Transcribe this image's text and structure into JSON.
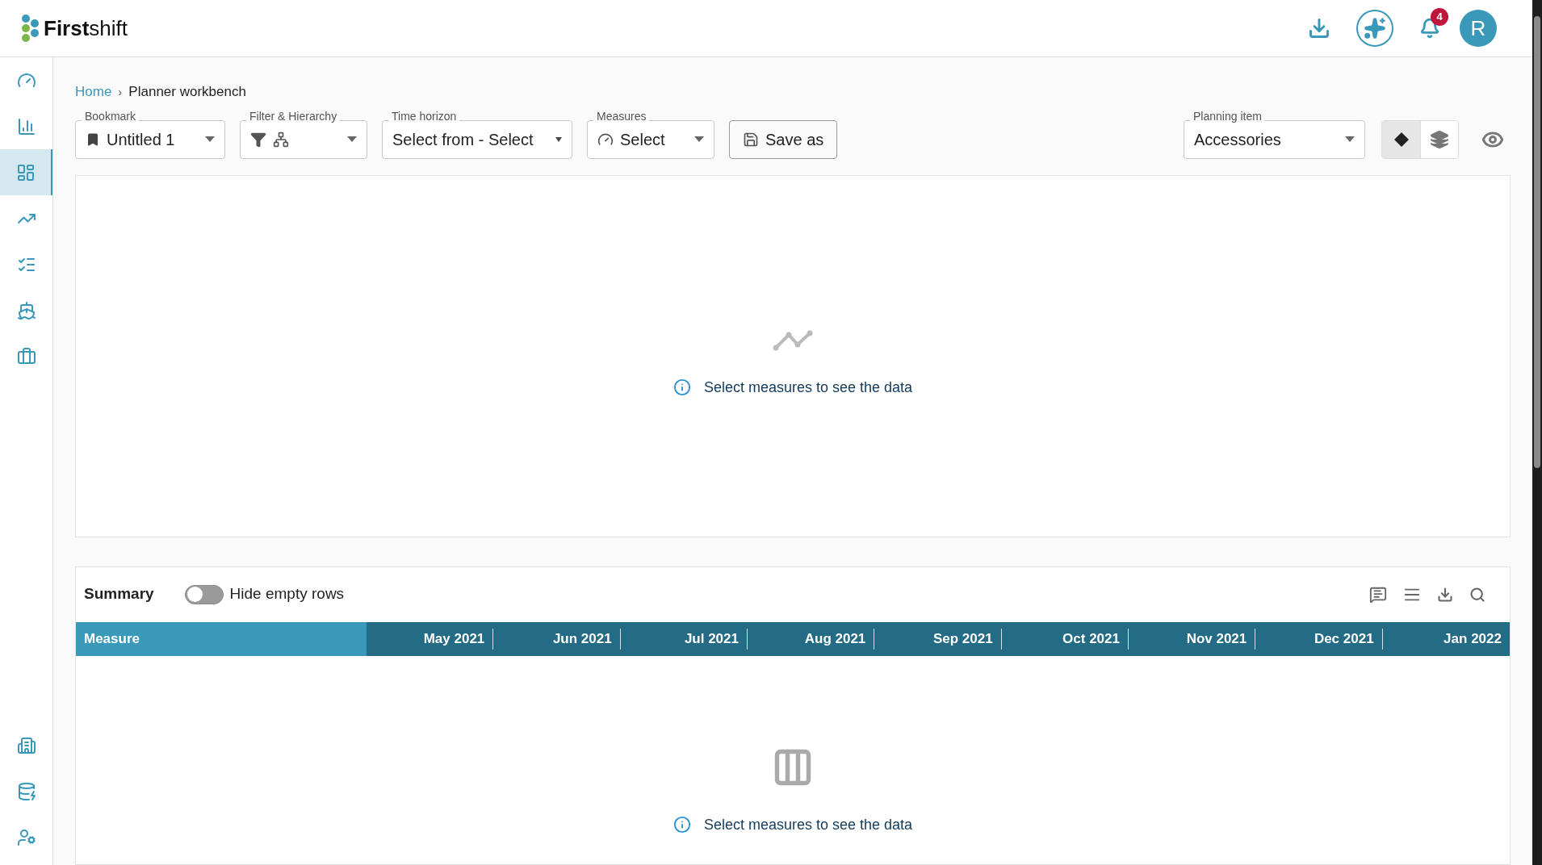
{
  "header": {
    "logo": "**First**shift",
    "notification_count": "4",
    "avatar": "R"
  },
  "sidebar": {
    "items": [
      {
        "kind": "gauge",
        "selected": false
      },
      {
        "kind": "bar-chart",
        "selected": false
      },
      {
        "kind": "layout",
        "selected": true
      },
      {
        "kind": "trend",
        "selected": false
      },
      {
        "kind": "checklist",
        "selected": false
      },
      {
        "kind": "ship",
        "selected": false
      },
      {
        "kind": "briefcase",
        "selected": false
      }
    ],
    "bottom_items": [
      {
        "kind": "building",
        "selected": false
      },
      {
        "kind": "database-settings",
        "selected": false
      },
      {
        "kind": "user-settings",
        "selected": false
      }
    ]
  },
  "breadcrumb": [
    {
      "label": "Home",
      "kind": "link"
    },
    {
      "label": "›",
      "kind": "separator"
    },
    {
      "label": "Planner workbench",
      "kind": "current"
    }
  ],
  "toolbar": {
    "bookmark": {
      "label": "Bookmark",
      "value": "Untitled 1"
    },
    "filter": {
      "label": "Filter & Hierarchy"
    },
    "time_horizon": {
      "label": "Time horizon",
      "value": "Select from - Select"
    },
    "measures": {
      "label": "Measures",
      "value": "Select"
    },
    "save_button": "Save as",
    "planning_item": {
      "label": "Planning item",
      "value": "Accessories"
    },
    "view_toggle": [
      {
        "kind": "single",
        "selected": true
      },
      {
        "kind": "layers",
        "selected": false
      }
    ]
  },
  "chart_panel": {
    "message": "Select measures to see the data"
  },
  "summary": {
    "title": "Summary",
    "hide_empty_rows": {
      "label": "Hide empty rows",
      "on": false
    },
    "columns": [
      "Measure",
      "May 2021",
      "Jun 2021",
      "Jul 2021",
      "Aug 2021",
      "Sep 2021",
      "Oct 2021",
      "Nov 2021",
      "Dec 2021",
      "Jan 2022"
    ],
    "message": "Select measures to see the data"
  }
}
